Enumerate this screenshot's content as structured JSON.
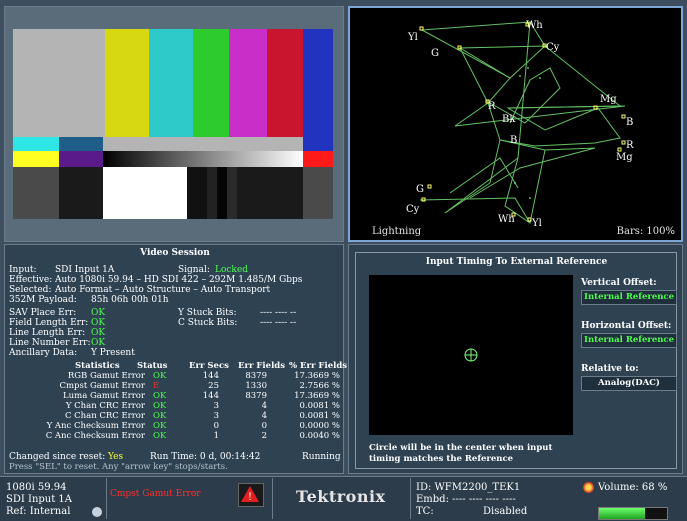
{
  "colors": {
    "locked": "#4dff4d",
    "error": "#ff3030",
    "yellow": "#ffff33",
    "accent": "#7fa7d6"
  },
  "lightning": {
    "title": "Lightning",
    "bars_label": "Bars: 100%",
    "labels": {
      "yl_top": "Yl",
      "wh_top": "Wh",
      "cy_top": "Cy",
      "g_top": "G",
      "mg_right": "Mg",
      "b_right": "B",
      "r_left": "R",
      "bk": "Bk",
      "b_mid": "B",
      "r_right": "R",
      "mg_right2": "Mg",
      "g_bottom": "G",
      "cy_bottom": "Cy",
      "wh_bottom": "Wh",
      "yl_bottom": "Yl"
    }
  },
  "session": {
    "title": "Video Session",
    "input_label": "Input:",
    "input_value": "SDI Input 1A",
    "signal_label": "Signal:",
    "signal_value": "Locked",
    "effective_label": "Effective:",
    "effective_value": "Auto 1080i 59.94 – HD SDI 422 – 292M 1.485/M Gbps",
    "selected_label": "Selected:",
    "selected_value": "Auto Format – Auto Structure – Auto Transport",
    "payload_label": "352M Payload:",
    "payload_value": "85h 06h 00h 01h",
    "sav_label": "SAV Place Err:",
    "sav_value": "OK",
    "field_label": "Field Length Err:",
    "field_value": "OK",
    "line_label": "Line Length Err:",
    "line_value": "OK",
    "linenum_label": "Line Number Err:",
    "linenum_value": "OK",
    "anc_label": "Ancillary Data:",
    "anc_value": "Y Present",
    "ystuck_label": "Y Stuck Bits:",
    "ystuck_value": "---- ---- --",
    "cstuck_label": "C Stuck Bits:",
    "cstuck_value": "---- ---- --",
    "columns": [
      "Statistics",
      "Status",
      "Err Secs",
      "Err Fields",
      "% Err Fields"
    ],
    "rows": [
      {
        "name": "RGB Gamut Error",
        "status": "OK",
        "secs": "144",
        "fields": "8379",
        "pct": "17.3669 %"
      },
      {
        "name": "Cmpst Gamut Error",
        "status": "E",
        "secs": "25",
        "fields": "1330",
        "pct": "2.7566 %"
      },
      {
        "name": "Luma Gamut Error",
        "status": "OK",
        "secs": "144",
        "fields": "8379",
        "pct": "17.3669 %"
      },
      {
        "name": "Y Chan CRC Error",
        "status": "OK",
        "secs": "3",
        "fields": "4",
        "pct": "0.0081 %"
      },
      {
        "name": "C Chan CRC Error",
        "status": "OK",
        "secs": "3",
        "fields": "4",
        "pct": "0.0081 %"
      },
      {
        "name": "Y Anc Checksum Error",
        "status": "OK",
        "secs": "0",
        "fields": "0",
        "pct": "0.0000 %"
      },
      {
        "name": "C Anc Checksum Error",
        "status": "OK",
        "secs": "1",
        "fields": "2",
        "pct": "0.0040 %"
      }
    ],
    "changed_label": "Changed since reset:",
    "changed_value": "Yes",
    "runtime_label": "Run Time: 0 d, 00:14:42",
    "running": "Running",
    "hint": "Press \"SEL\" to reset.  Any \"arrow key\" stops/starts."
  },
  "timing": {
    "title": "Input Timing To External Reference",
    "vertical_label": "Vertical Offset:",
    "vertical_value": "Internal Reference",
    "horizontal_label": "Horizontal Offset:",
    "horizontal_value": "Internal Reference",
    "relative_label": "Relative to:",
    "relative_value": "Analog(DAC)",
    "note": "Circle will be in the center when input timing matches the Reference"
  },
  "statusbar": {
    "format": "1080i 59.94",
    "input": "SDI Input 1A",
    "ref": "Ref: Internal",
    "alarm": "Cmpst Gamut Error",
    "brand": "Tektronix",
    "id": "ID: WFM2200_TEK1",
    "embd": "Embd: ---- ---- ---- ----",
    "tc_label": "TC:",
    "tc_value": "Disabled",
    "volume": "Volume: 68 %",
    "volume_level": 0.68
  }
}
